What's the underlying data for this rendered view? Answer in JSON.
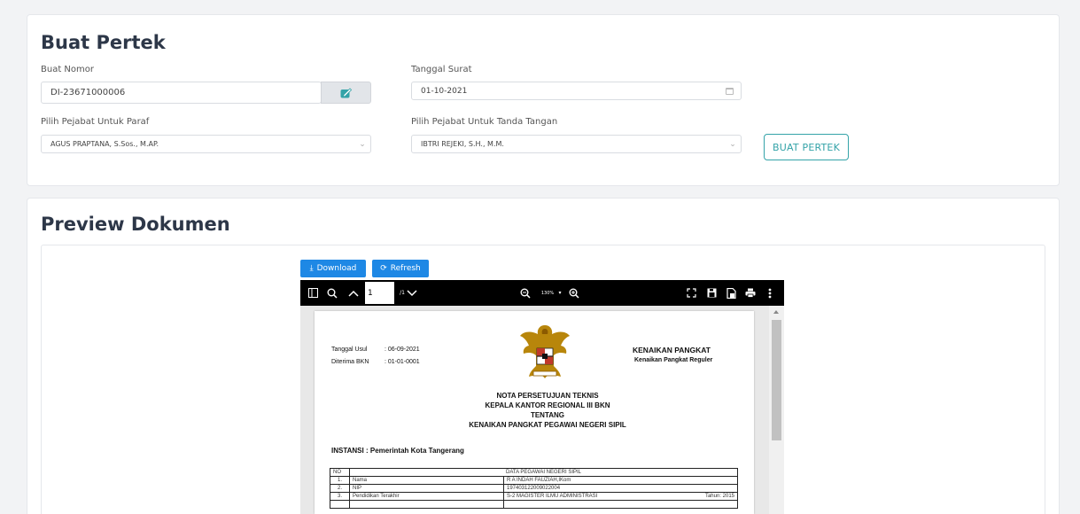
{
  "form": {
    "title": "Buat Pertek",
    "nomor_label": "Buat Nomor",
    "nomor_value": "DI-23671000006",
    "tanggal_label": "Tanggal Surat",
    "tanggal_value": "01-10-2021",
    "paraf_label": "Pilih Pejabat Untuk Paraf",
    "paraf_value": "AGUS PRAPTANA, S.Sos., M.AP.",
    "ttd_label": "Pilih Pejabat Untuk Tanda Tangan",
    "ttd_value": "IBTRI REJEKI, S.H., M.M.",
    "submit_label": "BUAT PERTEK",
    "accent_color": "#34a3a8"
  },
  "preview": {
    "title": "Preview Dokumen",
    "download_label": "Download",
    "refresh_label": "Refresh",
    "page_input": "1",
    "page_total": "/1",
    "zoom": "130%",
    "icons": [
      "sidebar-toggle-icon",
      "search-icon",
      "chevron-up-icon",
      "chevron-down-icon",
      "zoom-out-icon",
      "zoom-in-icon",
      "fullscreen-icon",
      "save-icon",
      "document-icon",
      "print-icon",
      "more-icon"
    ]
  },
  "document": {
    "tanggal_usul_label": "Tanggal Usul",
    "tanggal_usul_value": ": 06-09-2021",
    "diterima_label": "Diterima BKN",
    "diterima_value": ": 01-01-0001",
    "kenaikan_title": "KENAIKAN PANGKAT",
    "kenaikan_sub": "Kenaikan Pangkat Reguler",
    "heading": [
      "NOTA PERSETUJUAN TEKNIS",
      "KEPALA KANTOR REGIONAL III BKN",
      "TENTANG",
      "KENAIKAN PANGKAT PEGAWAI NEGERI SIPIL"
    ],
    "instansi": "INSTANSI :  Pemerintah Kota Tangerang",
    "table_header_no": "NO",
    "table_header_title": "DATA PEGAWAI NEGERI SIPIL",
    "rows": [
      {
        "no": "1.",
        "label": "Nama",
        "value": "R A INDAH FAUZIAH,IKom",
        "extra": ""
      },
      {
        "no": "2.",
        "label": "NIP",
        "value": "197403122009022004",
        "extra": ""
      },
      {
        "no": "3.",
        "label": "Pendidikan Terakhir",
        "value": "S-2 MAGISTER ILMU ADMINISTRASI",
        "extra": "Tahun:  2015"
      }
    ]
  }
}
